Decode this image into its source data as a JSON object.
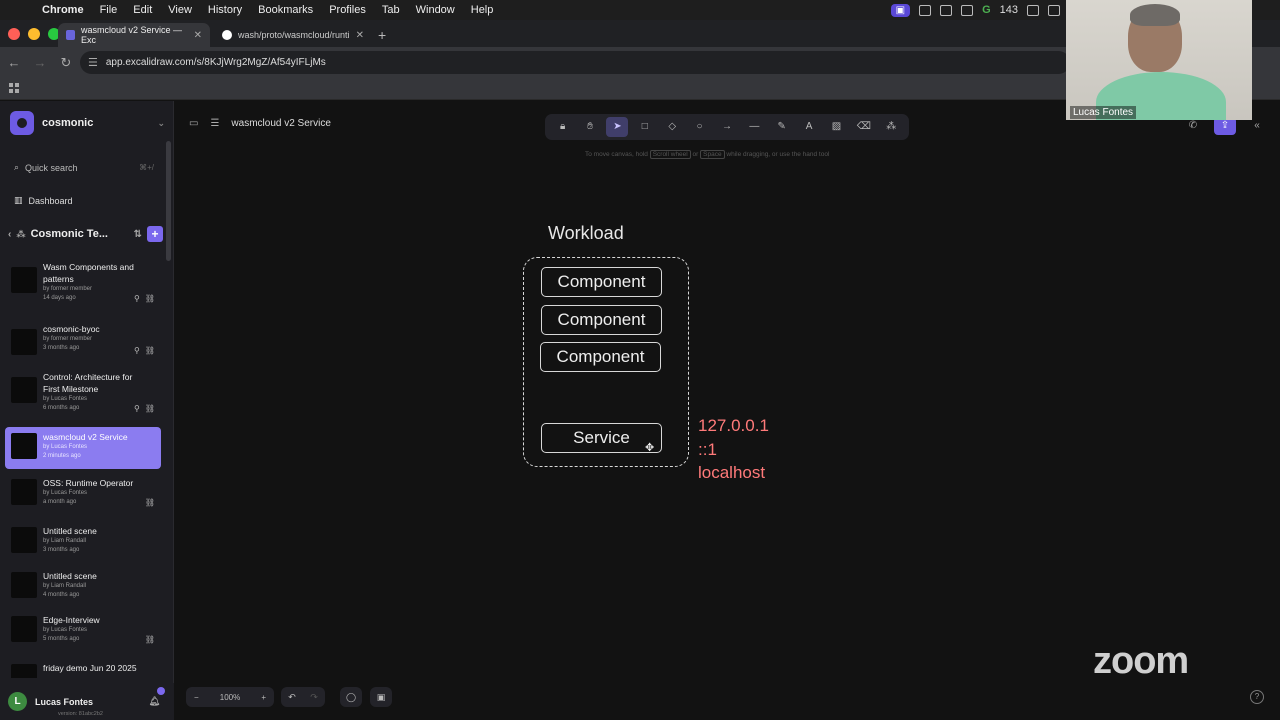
{
  "menubar": {
    "app": "Chrome",
    "items": [
      "File",
      "Edit",
      "View",
      "History",
      "Bookmarks",
      "Profiles",
      "Tab",
      "Window",
      "Help"
    ],
    "notification_count": "143"
  },
  "browser": {
    "tabs": [
      {
        "label": "wasmcloud v2 Service — Exc"
      },
      {
        "label": "wash/proto/wasmcloud/runti"
      }
    ],
    "url": "app.excalidraw.com/s/8KJjWrg2MgZ/Af54yIFLjMs"
  },
  "sidebar": {
    "workspace": "cosmonic",
    "search_label": "Quick search",
    "search_shortcut": "⌘+/",
    "dashboard_label": "Dashboard",
    "team_name": "Cosmonic Te...",
    "scenes": [
      {
        "title": "Wasm Components and patterns",
        "author": "by former member",
        "time": "14 days ago"
      },
      {
        "title": "cosmonic-byoc",
        "author": "by former member",
        "time": "3 months ago"
      },
      {
        "title": "Control: Architecture for First Milestone",
        "author": "by Lucas Fontes",
        "time": "6 months ago"
      },
      {
        "title": "wasmcloud v2 Service",
        "author": "by Lucas Fontes",
        "time": "2 minutes ago"
      },
      {
        "title": "OSS: Runtime Operator",
        "author": "by Lucas Fontes",
        "time": "a month ago"
      },
      {
        "title": "Untitled scene",
        "author": "by Liam Randall",
        "time": "3 months ago"
      },
      {
        "title": "Untitled scene",
        "author": "by Liam Randall",
        "time": "4 months ago"
      },
      {
        "title": "Edge-Interview",
        "author": "by Lucas Fontes",
        "time": "5 months ago"
      },
      {
        "title": "friday demo Jun 20 2025",
        "author": "",
        "time": ""
      }
    ],
    "user_name": "Lucas Fontes",
    "user_initial": "L",
    "version": "version: 81abc2b2"
  },
  "canvas": {
    "scene_title": "wasmcloud v2 Service",
    "hint": "To move canvas, hold",
    "hint_key1": "Scroll wheel",
    "hint_or": "or",
    "hint_key2": "Space",
    "hint_tail": "while dragging, or use the hand tool",
    "zoom_level": "100%"
  },
  "drawing": {
    "workload_label": "Workload",
    "components": [
      "Component",
      "Component",
      "Component"
    ],
    "service_label": "Service",
    "addresses": [
      "127.0.0.1",
      "::1",
      "localhost"
    ]
  },
  "meeting": {
    "participant_name": "Lucas Fontes",
    "brand": "zoom"
  },
  "colors": {
    "accent": "#6d5be3",
    "address_text": "#ff7a7a",
    "active_scene": "#8b7cf0"
  }
}
